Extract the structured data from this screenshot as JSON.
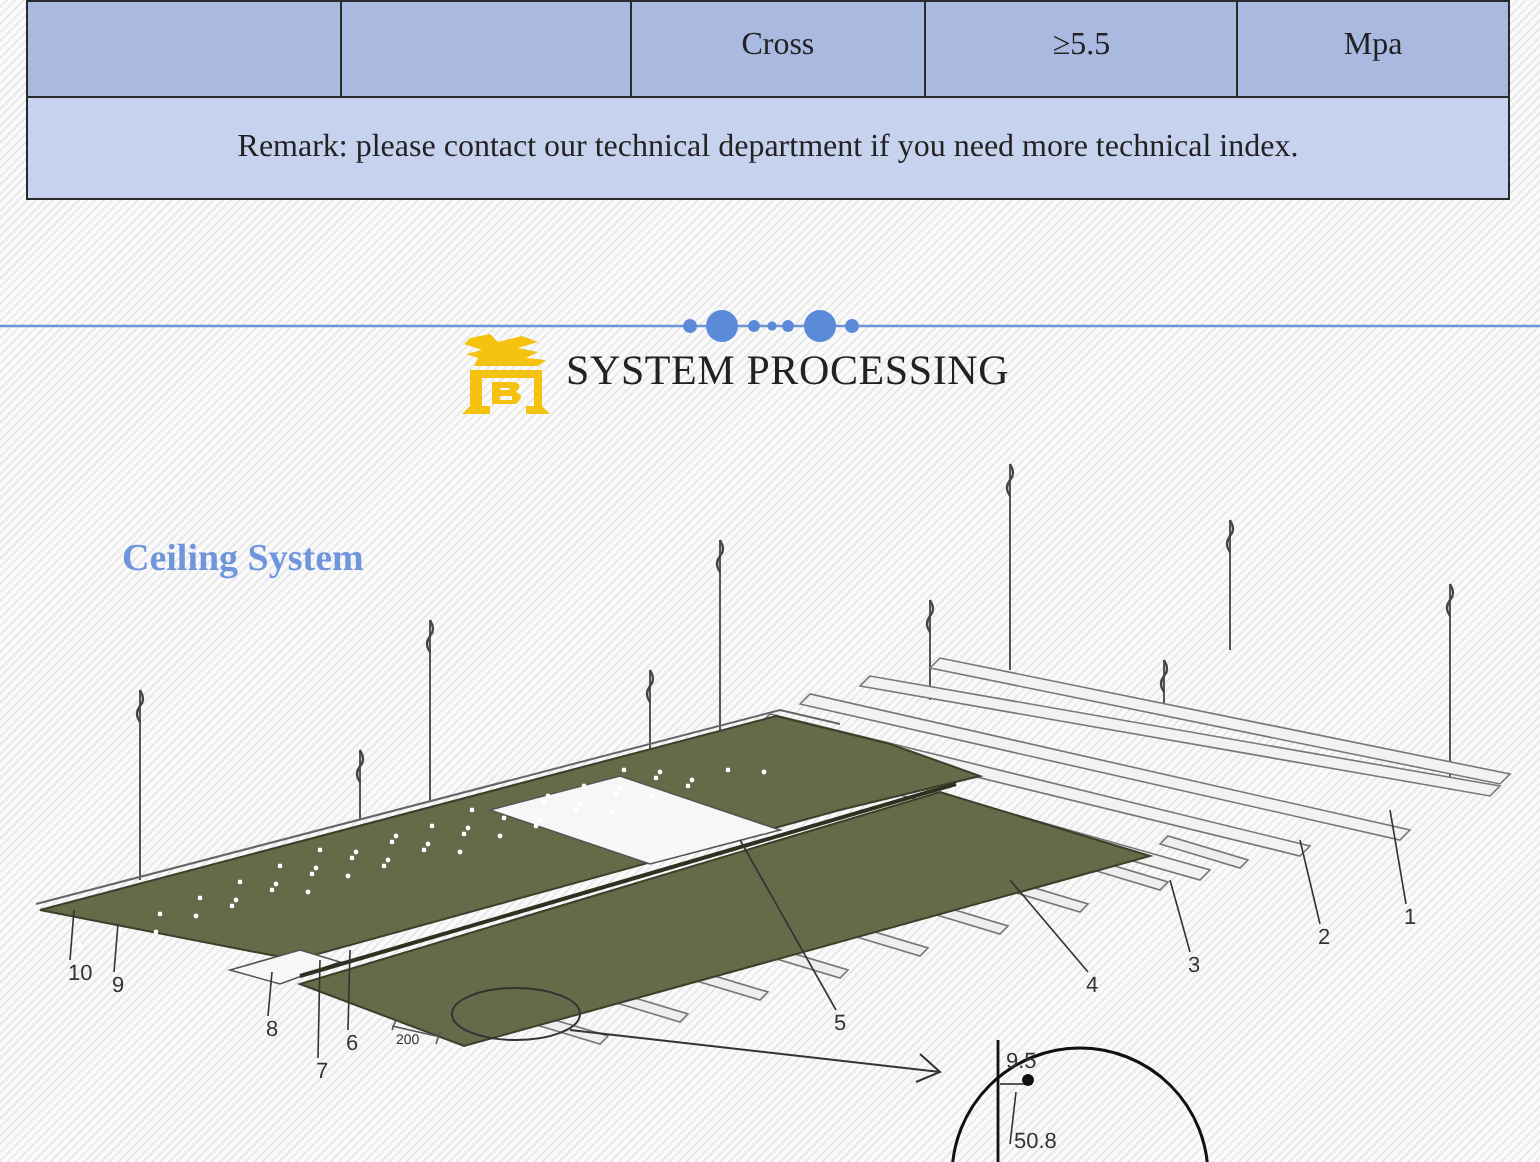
{
  "spec_table": {
    "last_row": {
      "cells": [
        {
          "text": "Cross"
        },
        {
          "text": "≥5.5"
        },
        {
          "text": "Mpa"
        }
      ]
    },
    "remark": "Remark: please contact our technical department if you need more technical index."
  },
  "section": {
    "title": "SYSTEM PROCESSING"
  },
  "diagram": {
    "title": "Ceiling System",
    "part_labels": [
      {
        "text": "1"
      },
      {
        "text": "2"
      },
      {
        "text": "3"
      },
      {
        "text": "4"
      },
      {
        "text": "5"
      },
      {
        "text": "6"
      },
      {
        "text": "7"
      },
      {
        "text": "8"
      },
      {
        "text": "9"
      },
      {
        "text": "10"
      }
    ],
    "spacing_label": "200",
    "detail_labels": [
      {
        "text": "9.5"
      },
      {
        "text": "50.8"
      }
    ]
  }
}
